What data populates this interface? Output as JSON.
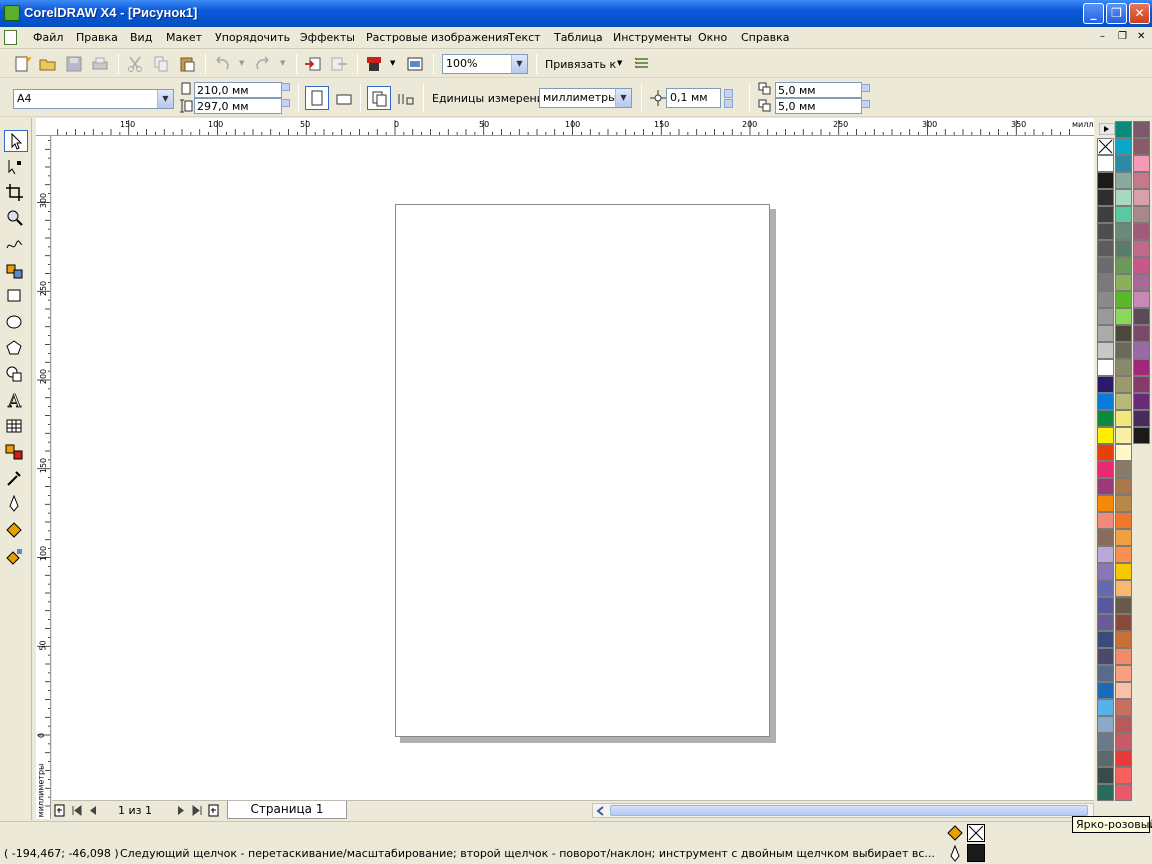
{
  "window": {
    "title": "CorelDRAW X4 - [Рисунок1]",
    "min_glyph": "_",
    "max_glyph": "❐",
    "close_glyph": "✕"
  },
  "menu": {
    "items": [
      "Файл",
      "Правка",
      "Вид",
      "Макет",
      "Упорядочить",
      "Эффекты",
      "Растровые изображения",
      "Текст",
      "Таблица",
      "Инструменты",
      "Окно",
      "Справка"
    ],
    "mdi_min": "–",
    "mdi_restore": "❐",
    "mdi_close": "✕"
  },
  "toolbar": {
    "zoom": "100%",
    "snap_label": "Привязать к",
    "dropdown_glyph": "▼"
  },
  "propbar": {
    "paper": "A4",
    "width": "210,0 мм",
    "height": "297,0 мм",
    "units_label": "Единицы измерения:",
    "units": "миллиметры",
    "nudge": "0,1 мм",
    "dup_x": "5,0 мм",
    "dup_y": "5,0 мм"
  },
  "ruler": {
    "h_labels": [
      "150",
      "100",
      "50",
      "0",
      "50",
      "100",
      "150",
      "200",
      "250",
      "300",
      "350"
    ],
    "h_unit": "милл",
    "v_labels": [
      "300",
      "250",
      "200",
      "150",
      "100",
      "50",
      "0"
    ],
    "v_unit": "миллиметры"
  },
  "navigator": {
    "page_count": "1 из 1",
    "page_tab": "Страница 1"
  },
  "status": {
    "coords": "( -194,467; -46,098 )",
    "message": "Следующий щелчок - перетаскивание/масштабирование; второй щелчок - поворот/наклон; инструмент с двойным щелчком выбирает вс..."
  },
  "tooltip": "Ярко-розовый",
  "palette": {
    "col1": [
      "#ffffff",
      "#1a1a1a",
      "#2e2e2e",
      "#3f3f3f",
      "#4e4e4e",
      "#5c5c5c",
      "#6b6b6b",
      "#7a7a7a",
      "#8a8a8a",
      "#9a9a9a",
      "#ababab",
      "#c8c8c8",
      "#ffffff",
      "#2a1a6e",
      "#0a7ad8",
      "#0a8a3a",
      "#ffee00",
      "#e8400a",
      "#e82a72",
      "#9a3a7a",
      "#f58a0a",
      "#f08a7a",
      "#8a6a5a",
      "#b8a8d8",
      "#8878b8",
      "#6868b0",
      "#5858a0",
      "#6a5a98",
      "#3a4a7a",
      "#4a4a6a",
      "#5a6a8a",
      "#1a6ab8",
      "#5ab0e8",
      "#8aa8c8",
      "#6a7a8a",
      "#5a6a6a",
      "#3a4a4a",
      "#2a6a5a",
      "#3a7a6a",
      "#4a8a7a"
    ],
    "col2": [
      "#0a8a7a",
      "#0aa8c8",
      "#2a8aa8",
      "#8aa8a0",
      "#a8d8c0",
      "#5ac8a0",
      "#6a8a7a",
      "#5a7a6a",
      "#6a9a5a",
      "#8ab05a",
      "#5ab82a",
      "#8ad85a",
      "#4a4a3a",
      "#6a6a5a",
      "#8a8a6a",
      "#9a9a6a",
      "#b8b87a",
      "#f0e87a",
      "#f8f0a0",
      "#fff8c8",
      "#8a7a6a",
      "#a8784a",
      "#b8884a",
      "#f0782a",
      "#f0a040",
      "#f89050",
      "#f8c800",
      "#f8b870",
      "#6a5a4a",
      "#8a4a3a",
      "#c8703a",
      "#f08a6a",
      "#f8a080",
      "#f8c0a8",
      "#c87060",
      "#b85a5a",
      "#c85a6a",
      "#e83a3a",
      "#f86060",
      "#e85a6a"
    ],
    "col3": [
      "#7a5a6a",
      "#8a5a6a",
      "#f898b8",
      "#c8788a",
      "#d8a0a8",
      "#a8888a",
      "#a05a7a",
      "#c06a8a",
      "#c8588a",
      "#a8689a",
      "#c888b8",
      "#5a4a5a",
      "#7a4a6a",
      "#9a6aa8",
      "#a0287a",
      "#883a6a",
      "#6a2a7a",
      "#4a2a5a",
      "#1a1a1a"
    ]
  }
}
